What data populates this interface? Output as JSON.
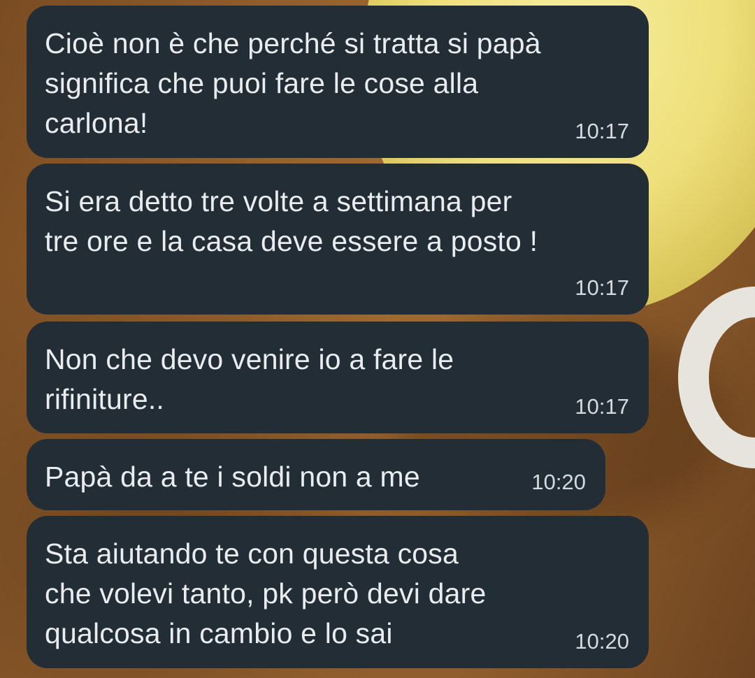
{
  "messages": [
    {
      "text": "Cioè non è che perché si tratta si papà\nsignifica che puoi fare le cose alla\ncarlona!",
      "time": "10:17"
    },
    {
      "text": "Si era detto tre volte a settimana per\ntre ore e la casa deve essere a posto !",
      "time": "10:17"
    },
    {
      "text": "Non che devo venire io a fare le\nrifiniture..",
      "time": "10:17"
    },
    {
      "text": "Papà da a te i soldi non a me",
      "time": "10:20"
    },
    {
      "text": "Sta aiutando te con questa cosa\nche volevi tanto, pk però devi dare\nqualcosa in cambio e lo sai",
      "time": "10:20"
    }
  ]
}
